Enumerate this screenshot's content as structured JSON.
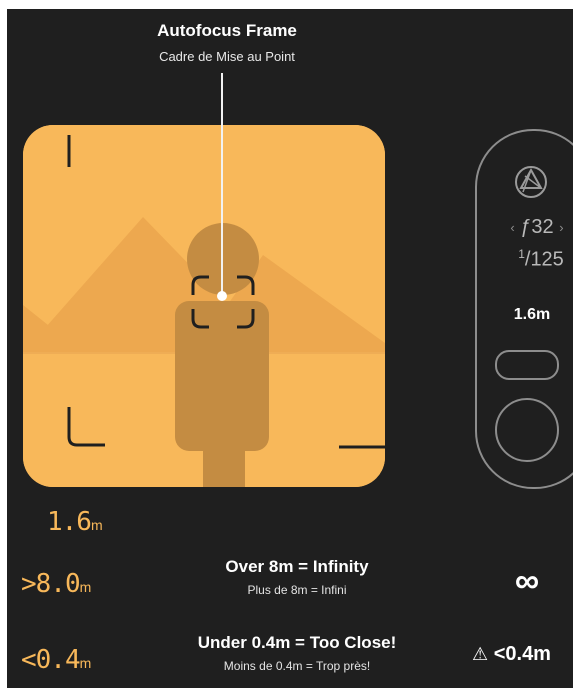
{
  "callout": {
    "title": "Autofocus Frame",
    "subtitle": "Cadre de Mise au Point"
  },
  "viewfinder": {
    "background_color": "#f8b85a",
    "subject_color": "#c48c42",
    "mountain_color": "#eda84f"
  },
  "camera_panel": {
    "mode_icon": "aperture-icon",
    "aperture_prev": "‹",
    "aperture": "ƒ32",
    "aperture_next": "›",
    "shutter_numerator": "1",
    "shutter_denominator": "125",
    "distance": "1.6m"
  },
  "focus_readout": {
    "current": {
      "value": "1.6",
      "unit": "m"
    },
    "far": {
      "value": ">8.0",
      "unit": "m",
      "title": "Over 8m = Infinity",
      "subtitle": "Plus de 8m = Infini",
      "symbol": "∞"
    },
    "near": {
      "value": "<0.4",
      "unit": "m",
      "title": "Under 0.4m = Too Close!",
      "subtitle": "Moins de 0.4m = Trop près!",
      "warning_icon": "warning-icon",
      "symbol": "⚠",
      "label": "<0.4m"
    }
  },
  "colors": {
    "accent": "#f8b85a",
    "panel": "#1f1f1f",
    "outline": "#8d8d8d"
  }
}
